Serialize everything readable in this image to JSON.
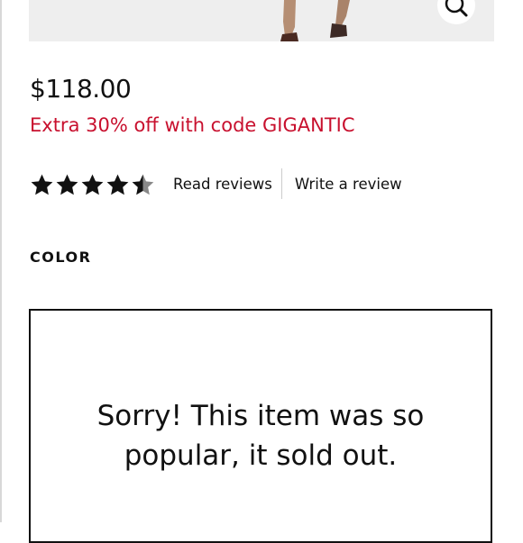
{
  "product": {
    "price": "$118.00",
    "promo": "Extra 30% off with code GIGANTIC",
    "zoom_icon": "magnifier-zoom-icon",
    "rating": {
      "value": 4.5,
      "max": 5,
      "read_reviews_label": "Read reviews",
      "write_review_label": "Write a review"
    },
    "color_label": "COLOR",
    "sold_out_message": "Sorry! This item was so popular, it sold out."
  },
  "colors": {
    "promo_red": "#c8102e",
    "text": "#111111"
  }
}
